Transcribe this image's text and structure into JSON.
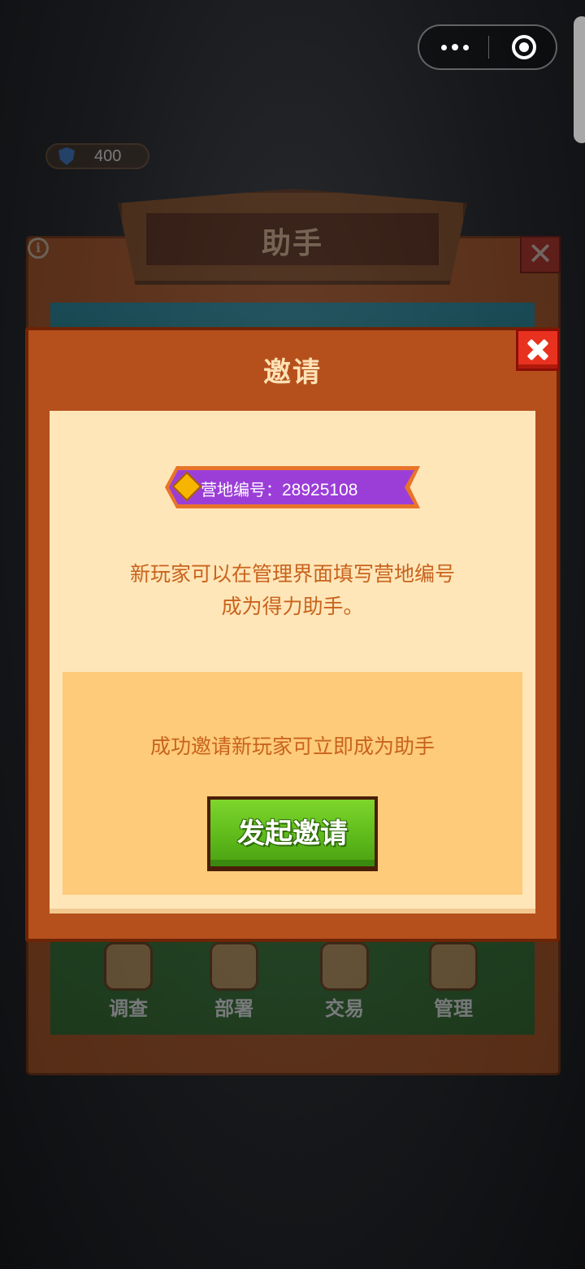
{
  "capsule": {
    "more_icon": "more-dots-icon",
    "close_icon": "target-circle-icon"
  },
  "currency": {
    "icon": "shield-star-icon",
    "amount": "400"
  },
  "background_panel": {
    "title": "助手",
    "nav": [
      {
        "label": "调查",
        "icon": "magnifier-clipboard-icon"
      },
      {
        "label": "部署",
        "icon": "map-pin-icon"
      },
      {
        "label": "交易",
        "icon": "register-coins-icon"
      },
      {
        "label": "管理",
        "icon": "gear-icon"
      }
    ]
  },
  "invite_modal": {
    "title": "邀请",
    "camp_label": "营地编号：",
    "camp_number": "28925108",
    "description_line1": "新玩家可以在管理界面填写营地编号",
    "description_line2": "成为得力助手。",
    "reward_text": "成功邀请新玩家可立即成为助手",
    "invite_button_label": "发起邀请"
  },
  "colors": {
    "modal_bg": "#b5501c",
    "body_bg": "#ffe6b8",
    "reward_bg": "#fdcb7a",
    "text_orange": "#c9631d",
    "tag_purple": "#9b3ed8",
    "button_green": "#5cb81a",
    "close_red": "#e8321f"
  }
}
